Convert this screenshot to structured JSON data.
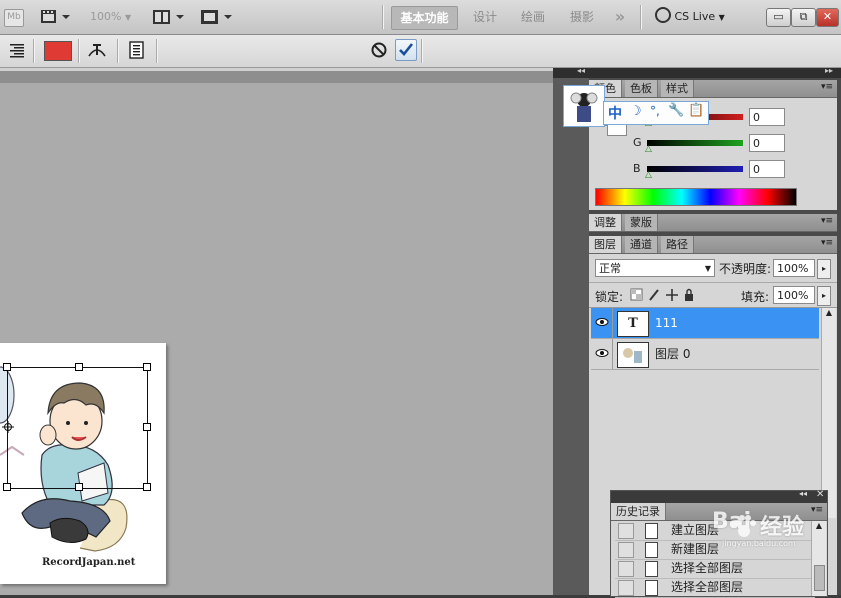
{
  "app_bar": {
    "bridge_label": "Mb",
    "zoom_value": "100%",
    "workspaces": [
      "基本功能",
      "设计",
      "绘画",
      "摄影"
    ],
    "more_label": "»",
    "cs_live": "CS Live",
    "win_buttons": [
      "▭",
      "⧉",
      "✕"
    ]
  },
  "options_bar": {
    "text_color": "#e03a35",
    "cancel_icon": "cancel-icon",
    "commit_icon": "commit-check-icon",
    "underline_color": "#e02020"
  },
  "color_panel": {
    "tabs": [
      "颜色",
      "色板",
      "样式"
    ],
    "menu": "▾≡",
    "rows": [
      {
        "label": "R",
        "value": "0",
        "color": "#d21f1f"
      },
      {
        "label": "G",
        "value": "0",
        "color": "#1fa21f"
      },
      {
        "label": "B",
        "value": "0",
        "color": "#1f1fb3"
      }
    ]
  },
  "ime_toolbar": {
    "items": [
      "中",
      "☽",
      "°,",
      "🔧",
      "📋"
    ]
  },
  "adjust_panel": {
    "tabs": [
      "调整",
      "蒙版"
    ],
    "menu": "▾≡"
  },
  "layers_panel": {
    "tabs": [
      "图层",
      "通道",
      "路径"
    ],
    "menu": "▾≡",
    "blend_mode": "正常",
    "opacity_label": "不透明度:",
    "opacity_value": "100%",
    "lock_label": "锁定:",
    "fill_label": "填充:",
    "fill_value": "100%",
    "layers": [
      {
        "name": "111",
        "thumb": "T",
        "selected": true
      },
      {
        "name": "图层 0",
        "thumb": "",
        "selected": false
      }
    ]
  },
  "history_panel": {
    "title": "历史记录",
    "menu": "▾≡",
    "items": [
      "建立图层",
      "新建图层",
      "选择全部图层",
      "选择全部图层"
    ]
  },
  "watermark": {
    "text": "经验",
    "logo": "Bai",
    "sub": "jingyan.baidu.com"
  },
  "document": {
    "brand_text": "RecordJapan.net"
  }
}
